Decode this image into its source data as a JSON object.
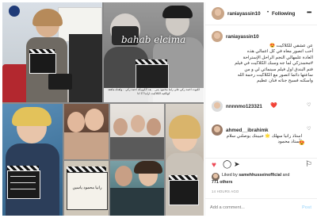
{
  "header": {
    "username": "raniayassin10",
    "separator": "•",
    "follow_label": "Following",
    "more_icon": "more-dots-icon"
  },
  "caption": {
    "username": "raniayassin10",
    "lines": [
      "عن عشقي للكلاكيت 😍",
      "أحب اتصور معاه في كل اعمالي هذه",
      "العادة علمهالي النجم الراحل الإستراحة",
      "#محمدزكي لما جه وسبك الكلاكيت في فيلم",
      "فتم البندق اول فيلم سينمائي لي و من",
      "ساعتها دائما اتصور مع الكلاكيت رحمة الله",
      "واسكنه فسيح جناته فنان عظيم"
    ]
  },
  "comments": [
    {
      "username": "nnnnmo123321",
      "text": "",
      "emoji": "❤️"
    },
    {
      "username": "ahmed__ibrahimk",
      "text": "استاذ رانيا سهلك 🌟 حبيبتك يوصلني سلام لأستاذ محمود",
      "emoji": "😍"
    }
  ],
  "actions": {
    "like_icon": "heart-icon",
    "comment_icon": "comment-icon",
    "share_icon": "share-icon",
    "save_icon": "bookmark-icon"
  },
  "likes": {
    "liked_by_prefix": "Liked by",
    "liked_by_user": "samehhusseinofficial",
    "and_label": "and",
    "others": "771 others"
  },
  "time_ago": "14 HOURS AGO",
  "add_comment": {
    "placeholder": "Add a comment...",
    "post_label": "Post"
  },
  "photo": {
    "overlay_handle": "bahab elcima",
    "clapper_text": "رانيا محمود ياسين",
    "center_caption": "لكيوت احمد زكي على رانيا محمود يس .. بعد الكونيكة احمد زكي .. ولقناه ماهعد كولكتيه الكلاكيت ارانيا 17 انا"
  },
  "colors": {
    "link": "#0095f6",
    "text": "#262626",
    "muted": "#8e8e8e",
    "heart_red": "#ed4956",
    "divider": "#efefef"
  }
}
